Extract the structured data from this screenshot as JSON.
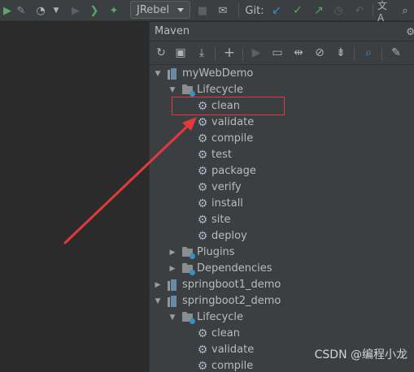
{
  "toolbar": {
    "run_config": "JRebel",
    "git_label": "Git:",
    "icons": [
      "run-icon",
      "attach-icon",
      "coverage-icon",
      "chevron-down-icon",
      "play-icon",
      "jrebel-run-icon",
      "jrebel-debug-icon",
      "stop-icon",
      "build-icon",
      "update-project-icon",
      "commit-icon",
      "push-icon",
      "history-icon",
      "rollback-icon",
      "translate-icon",
      "search-icon"
    ]
  },
  "panel": {
    "title": "Maven",
    "tool_icons": [
      "refresh-icon",
      "add-folder-icon",
      "download-icon",
      "add-icon",
      "run-icon",
      "execute-goal-icon",
      "toggle-offline-icon",
      "skip-tests-icon",
      "collapse-all-icon",
      "show-dependencies-icon",
      "settings-icon"
    ]
  },
  "tree": [
    {
      "level": 0,
      "arrow": "down",
      "icon": "module",
      "label": "myWebDemo"
    },
    {
      "level": 1,
      "arrow": "down",
      "icon": "folder",
      "label": "Lifecycle"
    },
    {
      "level": 2,
      "arrow": "",
      "icon": "gear",
      "label": "clean"
    },
    {
      "level": 2,
      "arrow": "",
      "icon": "gear",
      "label": "validate"
    },
    {
      "level": 2,
      "arrow": "",
      "icon": "gear",
      "label": "compile"
    },
    {
      "level": 2,
      "arrow": "",
      "icon": "gear",
      "label": "test"
    },
    {
      "level": 2,
      "arrow": "",
      "icon": "gear",
      "label": "package"
    },
    {
      "level": 2,
      "arrow": "",
      "icon": "gear",
      "label": "verify"
    },
    {
      "level": 2,
      "arrow": "",
      "icon": "gear",
      "label": "install"
    },
    {
      "level": 2,
      "arrow": "",
      "icon": "gear",
      "label": "site"
    },
    {
      "level": 2,
      "arrow": "",
      "icon": "gear",
      "label": "deploy"
    },
    {
      "level": 1,
      "arrow": "right",
      "icon": "folder",
      "label": "Plugins"
    },
    {
      "level": 1,
      "arrow": "right",
      "icon": "folder",
      "label": "Dependencies"
    },
    {
      "level": 0,
      "arrow": "right",
      "icon": "module",
      "label": "springboot1_demo"
    },
    {
      "level": 0,
      "arrow": "down",
      "icon": "module",
      "label": "springboot2_demo"
    },
    {
      "level": 1,
      "arrow": "down",
      "icon": "folder",
      "label": "Lifecycle"
    },
    {
      "level": 2,
      "arrow": "",
      "icon": "gear",
      "label": "clean"
    },
    {
      "level": 2,
      "arrow": "",
      "icon": "gear",
      "label": "validate"
    },
    {
      "level": 2,
      "arrow": "",
      "icon": "gear",
      "label": "compile"
    }
  ],
  "annotation": {
    "highlighted_item": "clean",
    "color": "#e03a3a"
  },
  "watermark": "CSDN @编程小龙",
  "colors": {
    "background": "#2b2b2b",
    "panel": "#3c3f41",
    "text": "#bbbbbb",
    "green": "#59a869",
    "blue": "#3592c4",
    "red": "#e03a3a"
  }
}
